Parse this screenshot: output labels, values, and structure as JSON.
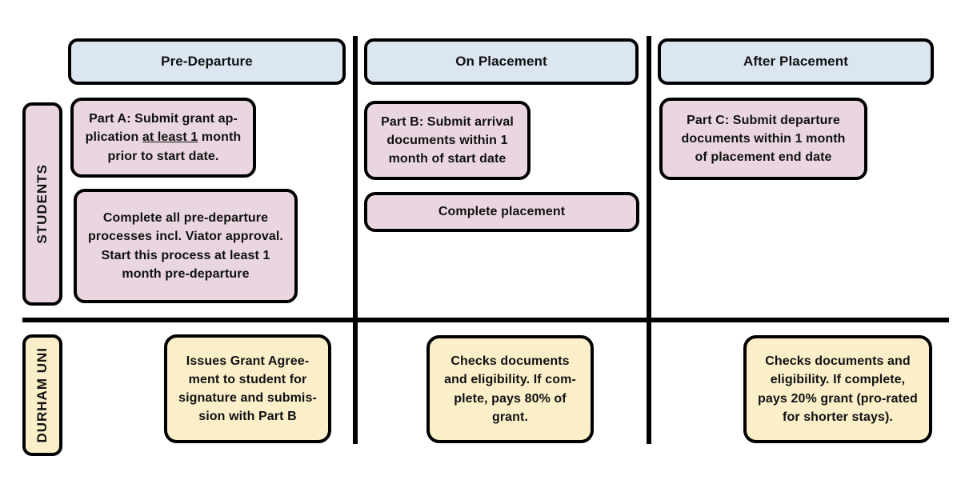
{
  "diagram": {
    "title": "Placement grant process swimlane diagram",
    "colors": {
      "header_fill": "#dce6f1",
      "student_fill": "#ead6e1",
      "university_fill": "#fbefc9",
      "outline": "#000000",
      "background": "#ffffff"
    },
    "phases": [
      {
        "id": "pre-departure",
        "label": "Pre-Departure"
      },
      {
        "id": "on-placement",
        "label": "On Placement"
      },
      {
        "id": "after-placement",
        "label": "After Placement"
      }
    ],
    "lanes": [
      {
        "id": "students",
        "label": "STUDENTS"
      },
      {
        "id": "durham-uni",
        "label": "DURHAM UNI"
      }
    ],
    "student_tasks": {
      "pre_departure": [
        {
          "id": "part-a",
          "text_before": "Part A: Submit grant ap-\nplication ",
          "text_underline": "at least 1",
          "text_after": " month\nprior to start date.",
          "plain_text": "Part A: Submit grant application at least 1 month prior to start date."
        },
        {
          "id": "pre-departure-processes",
          "text": "Complete all pre-departure\nprocesses incl. Viator approval.\nStart this process at least 1\nmonth pre-departure"
        }
      ],
      "on_placement": [
        {
          "id": "part-b",
          "text": "Part B: Submit arrival\ndocuments within 1\nmonth of start date"
        },
        {
          "id": "complete-placement",
          "text": "Complete placement"
        }
      ],
      "after_placement": [
        {
          "id": "part-c",
          "text": "Part C: Submit departure\ndocuments within 1 month\nof placement end date"
        }
      ]
    },
    "university_tasks": {
      "pre_departure": [
        {
          "id": "issue-grant-agreement",
          "text": "Issues Grant Agree-\nment to student for\nsignature and submis-\nsion with Part B"
        }
      ],
      "on_placement": [
        {
          "id": "checks-pays-80",
          "text": "Checks documents\nand eligibility. If com-\nplete, pays 80% of\ngrant."
        }
      ],
      "after_placement": [
        {
          "id": "checks-pays-20",
          "text": "Checks documents and\neligibility. If complete,\npays 20% grant (pro-rated\nfor shorter stays)."
        }
      ]
    }
  }
}
